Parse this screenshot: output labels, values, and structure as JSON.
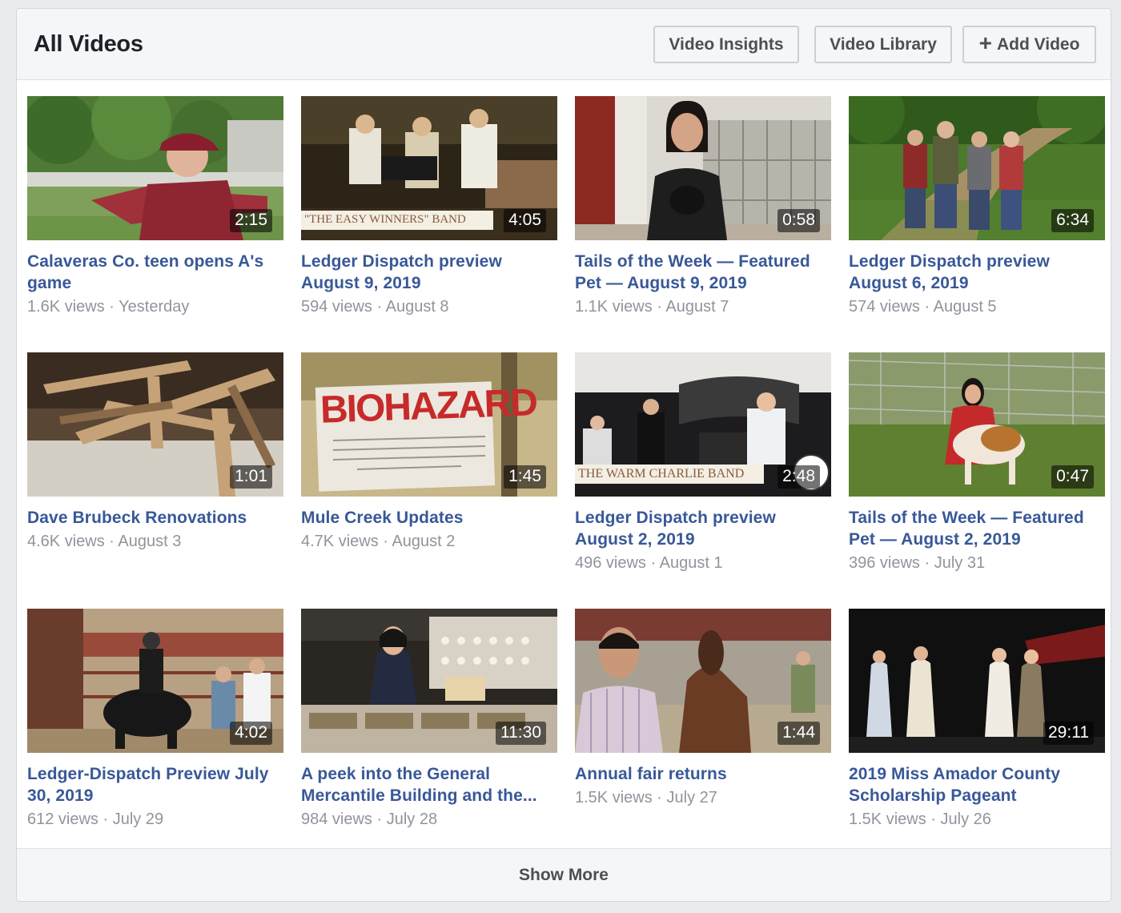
{
  "header": {
    "title": "All Videos",
    "buttons": {
      "insights": "Video Insights",
      "library": "Video Library",
      "add": "Add Video"
    }
  },
  "videos": [
    {
      "title": "Calaveras Co. teen opens A's game",
      "views": "1.6K views",
      "date": "Yesterday",
      "duration": "2:15"
    },
    {
      "title": "Ledger Dispatch preview August 9, 2019",
      "views": "594 views",
      "date": "August 8",
      "duration": "4:05",
      "overlay": "\"THE EASY WINNERS\" BAND"
    },
    {
      "title": "Tails of the Week — Featured Pet — August 9, 2019",
      "views": "1.1K views",
      "date": "August 7",
      "duration": "0:58"
    },
    {
      "title": "Ledger Dispatch preview August 6, 2019",
      "views": "574 views",
      "date": "August 5",
      "duration": "6:34"
    },
    {
      "title": "Dave Brubeck Renovations",
      "views": "4.6K views",
      "date": "August 3",
      "duration": "1:01"
    },
    {
      "title": "Mule Creek Updates",
      "views": "4.7K views",
      "date": "August 2",
      "duration": "1:45",
      "overlay": "BIOHAZARD"
    },
    {
      "title": "Ledger Dispatch preview August 2, 2019",
      "views": "496 views",
      "date": "August 1",
      "duration": "2:48",
      "overlay": "THE WARM CHARLIE BAND"
    },
    {
      "title": "Tails of the Week — Featured Pet — August 2, 2019",
      "views": "396 views",
      "date": "July 31",
      "duration": "0:47"
    },
    {
      "title": "Ledger-Dispatch Preview July 30, 2019",
      "views": "612 views",
      "date": "July 29",
      "duration": "4:02"
    },
    {
      "title": "A peek into the General Mercantile Building and the...",
      "views": "984 views",
      "date": "July 28",
      "duration": "11:30"
    },
    {
      "title": "Annual fair returns",
      "views": "1.5K views",
      "date": "July 27",
      "duration": "1:44"
    },
    {
      "title": "2019 Miss Amador County Scholarship Pageant",
      "views": "1.5K views",
      "date": "July 26",
      "duration": "29:11"
    }
  ],
  "meta_separator": " · ",
  "footer": {
    "show_more": "Show More"
  },
  "colors": {
    "link": "#385898",
    "meta": "#90949c",
    "header_bg": "#f5f6f7"
  }
}
